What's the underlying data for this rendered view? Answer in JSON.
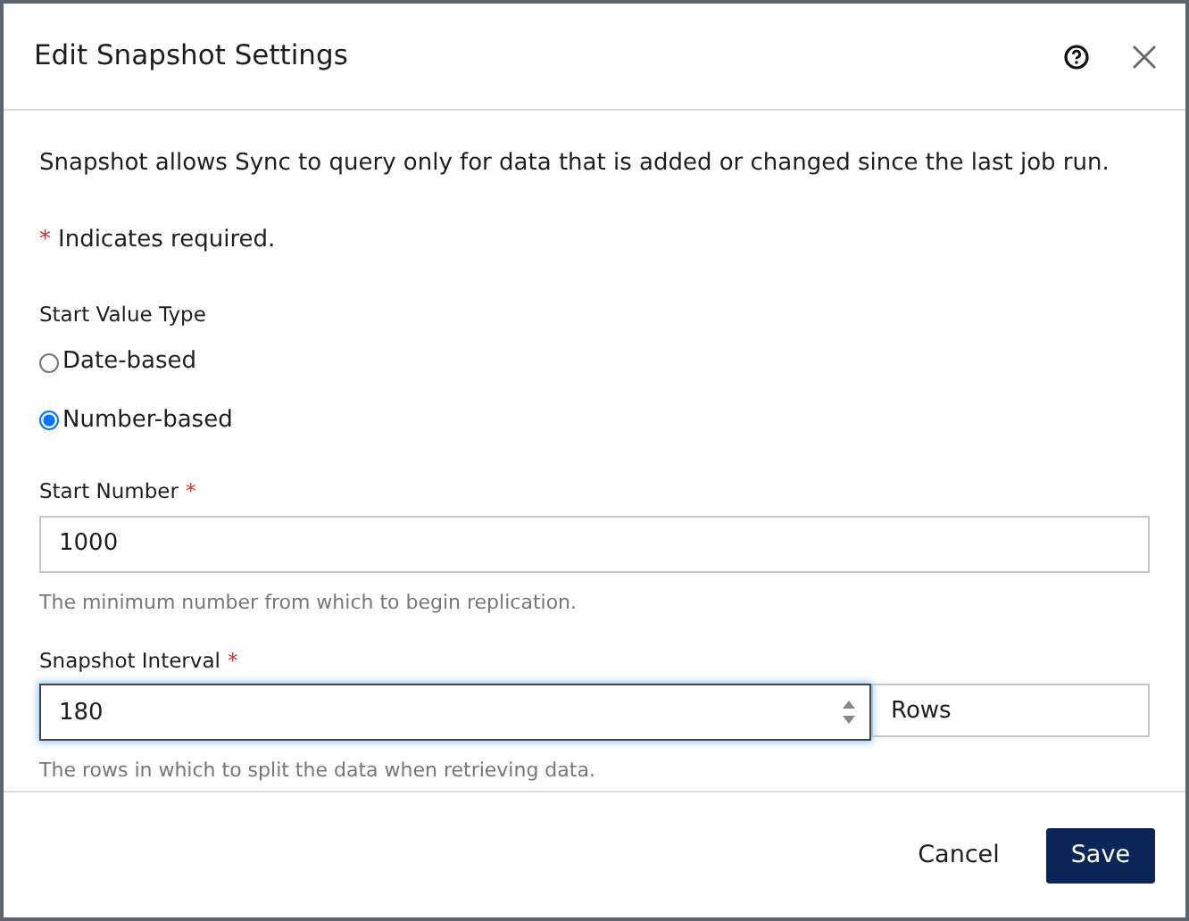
{
  "dialog": {
    "title": "Edit Snapshot Settings"
  },
  "intro": "Snapshot allows Sync to query only for data that is added or changed since the last job run.",
  "required_note": {
    "mark": "*",
    "text": "Indicates required."
  },
  "start_value_type": {
    "label": "Start Value Type",
    "options": [
      {
        "label": "Date-based",
        "selected": false
      },
      {
        "label": "Number-based",
        "selected": true
      }
    ]
  },
  "fields": [
    {
      "label": "Start Number",
      "required_mark": "*",
      "value": "1000",
      "focused": false,
      "help": "The minimum number from which to begin replication."
    },
    {
      "label": "Snapshot Interval",
      "required_mark": "*",
      "value": "180",
      "focused": true,
      "spinner": true,
      "unit": "Rows",
      "help": "The rows in which to split the data when retrieving data."
    }
  ],
  "buttons": [
    {
      "label": "Cancel",
      "kind": "link"
    },
    {
      "label": "Save",
      "kind": "primary"
    }
  ]
}
